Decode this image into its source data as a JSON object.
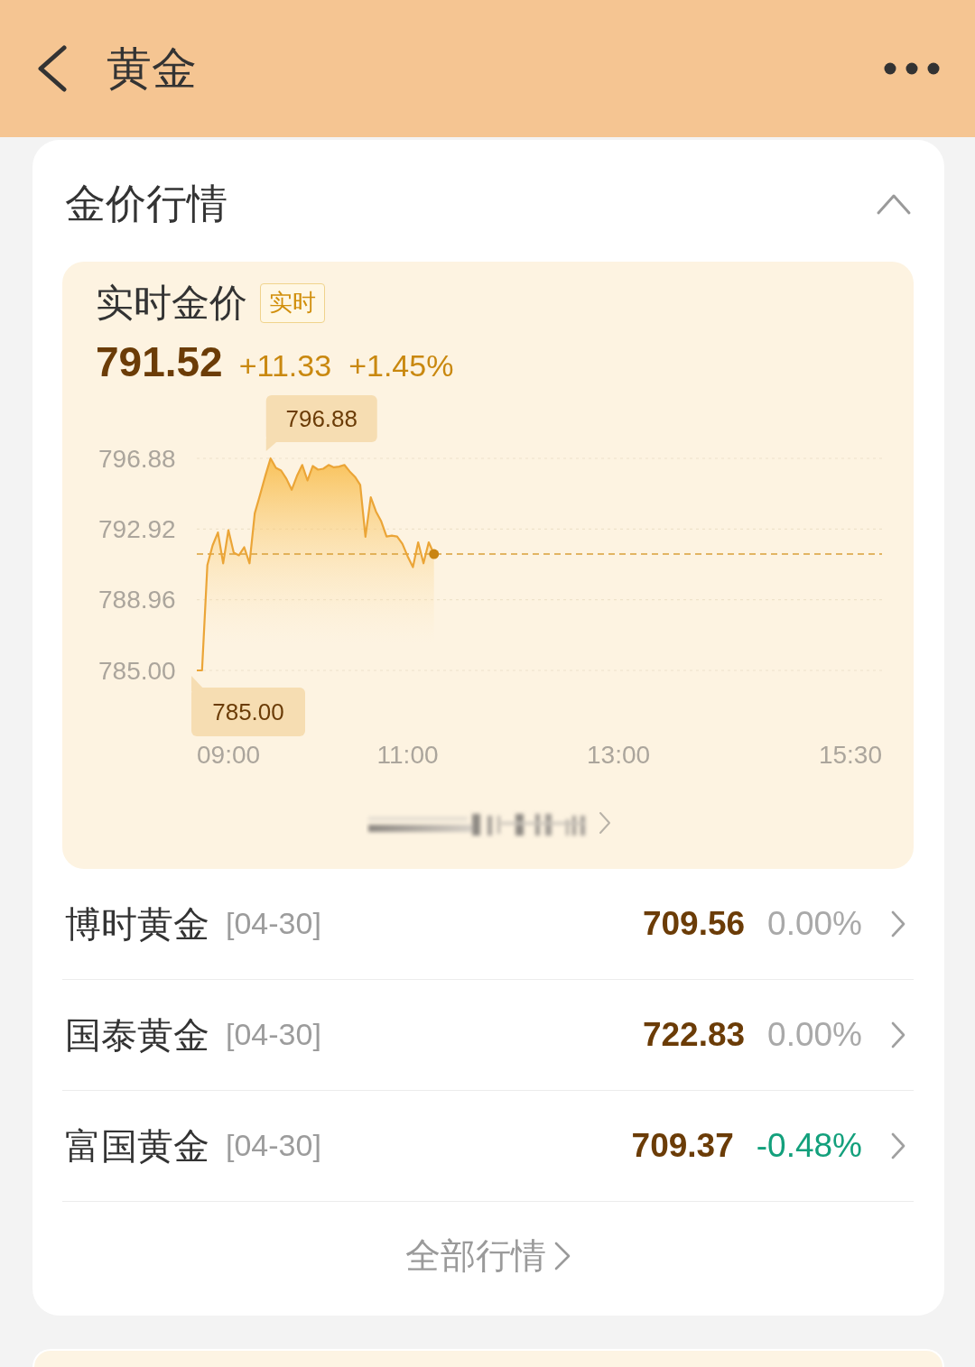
{
  "header": {
    "title": "黄金"
  },
  "section": {
    "title": "金价行情",
    "expanded": true
  },
  "live_quote": {
    "title": "实时金价",
    "tag": "实时",
    "price": "791.52",
    "change": "+11.33",
    "change_percent": "+1.45%",
    "chart_data": {
      "type": "area",
      "categories": [
        null,
        null,
        null,
        null,
        null,
        null,
        "09:00",
        null,
        null,
        null,
        null,
        null,
        null,
        null,
        null,
        null,
        null,
        null,
        null,
        null,
        null,
        null,
        null,
        null,
        null,
        null,
        null,
        null,
        null,
        null,
        null,
        null,
        null,
        null,
        null,
        null,
        null,
        null,
        null,
        null,
        "11:00",
        null,
        null,
        null,
        null,
        null,
        null,
        null,
        null,
        null,
        null,
        null,
        null,
        null,
        null,
        null,
        null,
        null,
        null,
        null,
        null,
        null,
        null,
        null,
        null,
        null,
        null,
        null,
        null,
        null,
        null,
        null,
        null,
        null,
        null,
        null,
        null,
        null,
        null,
        null,
        "13:00",
        null,
        null,
        null,
        null,
        null,
        null,
        null,
        null,
        null,
        null,
        null,
        null,
        null,
        null,
        null,
        null,
        null,
        null,
        null,
        null,
        null,
        null,
        null,
        null,
        null,
        null,
        null,
        null,
        null,
        null,
        null,
        null,
        null,
        null,
        null,
        null,
        null,
        null,
        null,
        null,
        null,
        null,
        null,
        "15:30",
        null,
        null,
        null,
        null,
        null,
        null
      ],
      "values": [
        785.0,
        785.0,
        790.9,
        792.0,
        792.73,
        791.0,
        792.86,
        791.6,
        791.45,
        791.9,
        791.0,
        793.8,
        794.85,
        795.9,
        796.88,
        796.35,
        796.2,
        795.74,
        795.12,
        795.89,
        796.51,
        795.64,
        796.45,
        796.25,
        796.3,
        796.51,
        796.38,
        796.42,
        796.51,
        796.15,
        795.85,
        795.4,
        792.49,
        794.7,
        793.9,
        793.35,
        792.5,
        792.55,
        792.5,
        792.1,
        791.4,
        790.79,
        792.18,
        791.0,
        792.18,
        791.52,
        null,
        null,
        null,
        null,
        null,
        null,
        null,
        null,
        null,
        null,
        null,
        null,
        null,
        null,
        null,
        null,
        null,
        null,
        null,
        null,
        null,
        null,
        null,
        null,
        null,
        null,
        null,
        null,
        null,
        null,
        null,
        null,
        null,
        null,
        null,
        null,
        null,
        null,
        null,
        null,
        null,
        null,
        null,
        null,
        null,
        null,
        null,
        null,
        null,
        null,
        null,
        null,
        null,
        null,
        null,
        null,
        null,
        null,
        null,
        null,
        null,
        null,
        null,
        null,
        null,
        null,
        null,
        null,
        null,
        null,
        null,
        null,
        null,
        null,
        null,
        null,
        null,
        null,
        null,
        null,
        null,
        null,
        null,
        null,
        null
      ],
      "ylim": [
        785.0,
        796.88
      ],
      "yticks": [
        {
          "value": 796.88,
          "label": "796.88"
        },
        {
          "value": 792.92,
          "label": "792.92"
        },
        {
          "value": 788.96,
          "label": "788.96"
        },
        {
          "value": 785.0,
          "label": "785.00"
        }
      ],
      "ref_lines": [
        {
          "axis": "y",
          "value": 791.52
        }
      ],
      "annotations": [
        "796.88",
        "785.00"
      ]
    }
  },
  "funds": [
    {
      "name": "博时黄金",
      "date": "[04-30]",
      "price": "709.56",
      "change": "0.00%",
      "color": "#a9a9a9"
    },
    {
      "name": "国泰黄金",
      "date": "[04-30]",
      "price": "722.83",
      "change": "0.00%",
      "color": "#a9a9a9"
    },
    {
      "name": "富国黄金",
      "date": "[04-30]",
      "price": "709.37",
      "change": "-0.48%",
      "color": "#13a07c"
    }
  ],
  "all_link": "全部行情"
}
